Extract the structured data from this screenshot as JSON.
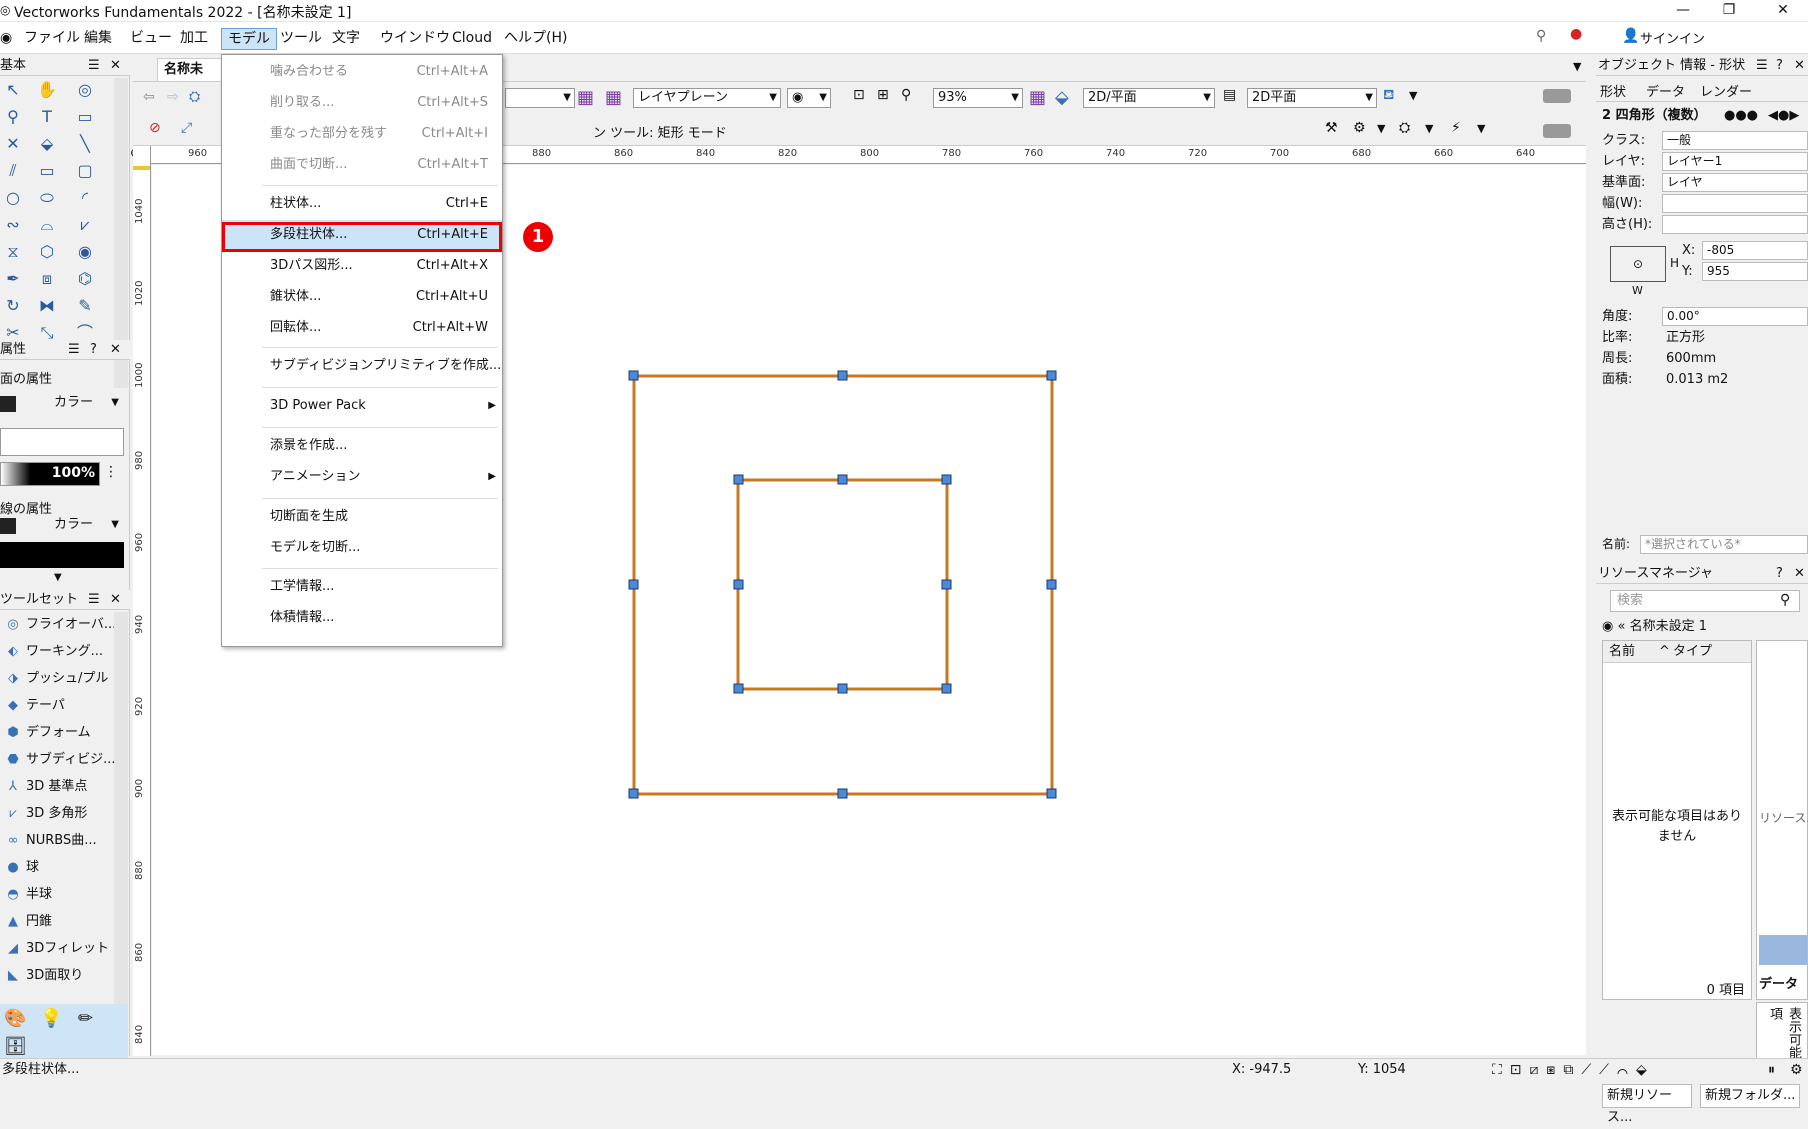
{
  "window": {
    "title": "Vectorworks Fundamentals 2022 - [名称未設定 1]",
    "minimize": "—",
    "restore": "❐",
    "close": "✕"
  },
  "menubar": {
    "items": [
      "ファイル",
      "編集",
      "ビュー",
      "加工",
      "モデル",
      "ツール",
      "文字",
      "ウインドウ",
      "Cloud",
      "ヘルプ(H)"
    ],
    "signin": "サインイン"
  },
  "doc_tab": "名称未",
  "toolbar": {
    "layer_plane": "レイヤプレーン",
    "zoom": "93%",
    "view": "2D/平面",
    "render": "2D平面",
    "mode_text": "ン ツール: 矩形 モード"
  },
  "ruler": {
    "top": [
      "960",
      "880",
      "860",
      "840",
      "820",
      "800",
      "780",
      "760",
      "740",
      "720",
      "700",
      "680",
      "660",
      "640"
    ],
    "left": [
      "1040",
      "1020",
      "1000",
      "980",
      "960",
      "940",
      "920",
      "900",
      "880",
      "860",
      "840"
    ]
  },
  "menu": {
    "items": [
      {
        "label": "噛み合わせる",
        "key": "Ctrl+Alt+A",
        "disabled": true
      },
      {
        "label": "削り取る...",
        "key": "Ctrl+Alt+S",
        "disabled": true
      },
      {
        "label": "重なった部分を残す",
        "key": "Ctrl+Alt+I",
        "disabled": true
      },
      {
        "label": "曲面で切断...",
        "key": "Ctrl+Alt+T",
        "disabled": true
      },
      {
        "label": "柱状体...",
        "key": "Ctrl+E"
      },
      {
        "label": "多段柱状体...",
        "key": "Ctrl+Alt+E",
        "highlight": true
      },
      {
        "label": "3Dパス図形...",
        "key": "Ctrl+Alt+X"
      },
      {
        "label": "錐状体...",
        "key": "Ctrl+Alt+U"
      },
      {
        "label": "回転体...",
        "key": "Ctrl+Alt+W"
      },
      {
        "label": "サブディビジョンプリミティブを作成...",
        "key": ""
      },
      {
        "label": "3D Power Pack",
        "key": "",
        "submenu": true
      },
      {
        "label": "添景を作成...",
        "key": ""
      },
      {
        "label": "アニメーション",
        "key": "",
        "submenu": true
      },
      {
        "label": "切断面を生成",
        "key": ""
      },
      {
        "label": "モデルを切断...",
        "key": ""
      },
      {
        "label": "工学情報...",
        "key": ""
      },
      {
        "label": "体積情報...",
        "key": ""
      }
    ],
    "step_badge": "❶"
  },
  "left": {
    "basic_title": "基本",
    "attr_title": "属性",
    "fill_label": "面の属性",
    "fill_mode": "カラー",
    "opacity": "100%",
    "line_label": "線の属性",
    "line_mode": "カラー",
    "toolset_title": "ツールセット",
    "toolset": [
      "フライオーバ...",
      "ワーキング...",
      "プッシュ/プル",
      "テーパ",
      "デフォーム",
      "サブディビジ...",
      "3D 基準点",
      "3D 多角形",
      "NURBS曲...",
      "球",
      "半球",
      "円錐",
      "3Dフィレット",
      "3D面取り"
    ]
  },
  "obj_info": {
    "title": "オブジェクト 情報 - 形状",
    "tabs": [
      "形状",
      "データ",
      "レンダー"
    ],
    "shape_name": "2 四角形（複数）",
    "class_label": "クラス:",
    "class_val": "一般",
    "layer_label": "レイヤ:",
    "layer_val": "レイヤー1",
    "plane_label": "基準面:",
    "plane_val": "レイヤ",
    "w_label": "幅(W):",
    "h_label": "高さ(H):",
    "x_label": "X:",
    "x_val": "-805",
    "y_label": "Y:",
    "y_val": "955",
    "H": "H",
    "W": "W",
    "angle_label": "角度:",
    "angle_val": "0.00°",
    "ratio_label": "比率:",
    "ratio_val": "正方形",
    "perim_label": "周長:",
    "perim_val": "600mm",
    "area_label": "面積:",
    "area_val": "0.013 m2",
    "name_label": "名前:",
    "name_val": "*選択されている*"
  },
  "resource": {
    "title": "リソースマネージャ",
    "search_placeholder": "検索",
    "file": "名称未設定 1",
    "col_name": "名前",
    "col_type": "タイプ",
    "empty": "表示可能な項目はありません",
    "count": "0 項目",
    "side_label": "リソース...",
    "data_label": "データ",
    "data_vertical": "表示可能な項",
    "new_resource": "新規リソース...",
    "new_folder": "新規フォルダ..."
  },
  "status": {
    "left": "多段柱状体...",
    "x": "X: -947.5",
    "y": "Y: 1054"
  }
}
